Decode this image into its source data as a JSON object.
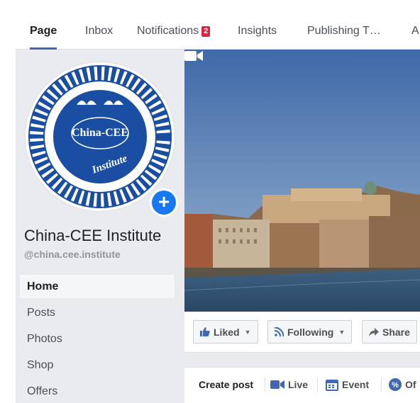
{
  "tabs": [
    {
      "label": "Page",
      "active": true
    },
    {
      "label": "Inbox"
    },
    {
      "label": "Notifications",
      "badge": "2"
    },
    {
      "label": "Insights"
    },
    {
      "label": "Publishing T…"
    },
    {
      "label": "A"
    }
  ],
  "profile": {
    "name": "China-CEE Institute",
    "handle": "@china.cee.institute",
    "logo_text_top": "China-CEE",
    "logo_text_bottom": "Institute"
  },
  "nav": [
    {
      "label": "Home",
      "active": true
    },
    {
      "label": "Posts"
    },
    {
      "label": "Photos"
    },
    {
      "label": "Shop"
    },
    {
      "label": "Offers"
    }
  ],
  "actions": {
    "liked": "Liked",
    "following": "Following",
    "share": "Share"
  },
  "composer": {
    "create_post": "Create post",
    "live": "Live",
    "event": "Event",
    "offer": "Of"
  },
  "colors": {
    "accent": "#4267b2",
    "badge": "#e41e3f",
    "logo_blue": "#1a4ea3",
    "add_button": "#1877f2"
  },
  "icons": [
    "video-camera-icon",
    "thumbs-up-icon",
    "rss-icon",
    "share-arrow-icon",
    "live-icon",
    "calendar-icon",
    "offer-icon",
    "plus-icon"
  ]
}
